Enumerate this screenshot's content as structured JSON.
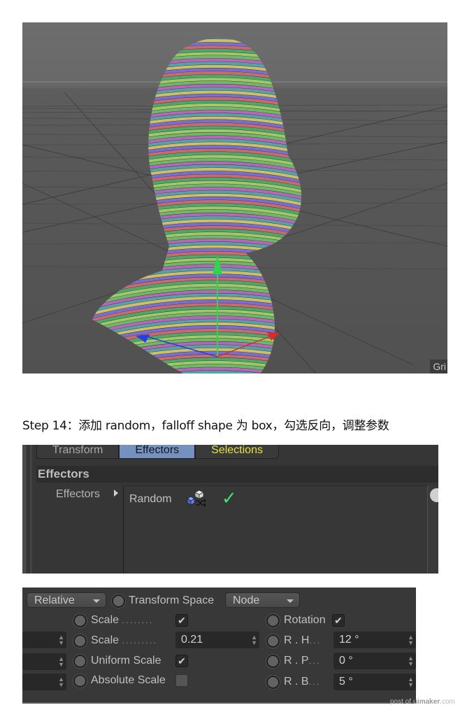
{
  "viewport": {
    "hud_label": "Gri",
    "axis_colors": {
      "y": "#2fd64a",
      "x": "#e02828",
      "z": "#2a3de0"
    },
    "stripe_colors": [
      "#6fb86a",
      "#b668b8",
      "#5aa0a8",
      "#c9c068",
      "#7a6fd0",
      "#c86a70",
      "#4fa86a",
      "#a0c86a"
    ]
  },
  "caption": "Step 14：添加 random，falloff shape 为 box，勾选反向，调整参数",
  "effectors_panel": {
    "tabs": [
      {
        "label": "Transform",
        "state": "normal"
      },
      {
        "label": "Effectors",
        "state": "active"
      },
      {
        "label": "Selections",
        "state": "highlight"
      }
    ],
    "section_title": "Effectors",
    "field_label": "Effectors",
    "list": [
      {
        "name": "Random",
        "icon": "random-effector-icon",
        "enabled": true
      }
    ]
  },
  "transform_panel": {
    "mode_dropdown": "Relative",
    "transform_space_label": "Transform Space",
    "transform_space_value": "Node",
    "left": [
      {
        "label": "Scale",
        "type": "checkbox",
        "checked": true,
        "dots": "........"
      },
      {
        "label": "Scale",
        "type": "number",
        "value": "0.21",
        "dots": "........."
      },
      {
        "label": "Uniform Scale",
        "type": "checkbox",
        "checked": true
      },
      {
        "label": "Absolute Scale",
        "type": "checkbox",
        "checked": false
      }
    ],
    "right": [
      {
        "label": "Rotation",
        "type": "checkbox",
        "checked": true
      },
      {
        "label": "R . H",
        "type": "number",
        "value": "12 °",
        "dots": "..."
      },
      {
        "label": "R . P",
        "type": "number",
        "value": "0 °",
        "dots": "..."
      },
      {
        "label": "R . B",
        "type": "number",
        "value": "5 °",
        "dots": "..."
      }
    ],
    "check_glyph": "✔"
  },
  "watermark": {
    "prefix": "post of ",
    "brand": "uimaker",
    "suffix": ".com"
  }
}
